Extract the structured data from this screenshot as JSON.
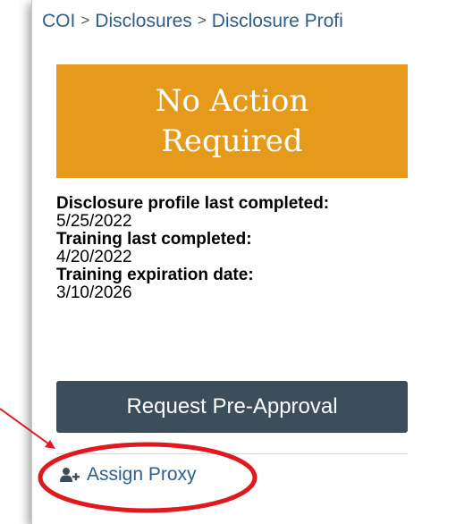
{
  "breadcrumb": [
    "COI",
    "Disclosures",
    "Disclosure Profi"
  ],
  "breadcrumb_separator": ">",
  "status": {
    "text": "No Action Required",
    "color": "#e59a1c"
  },
  "profile": [
    {
      "label": "Disclosure profile last completed:",
      "value": "5/25/2022"
    },
    {
      "label": "Training last completed:",
      "value": "4/20/2022"
    },
    {
      "label": "Training expiration date:",
      "value": "3/10/2026"
    }
  ],
  "actions": {
    "request_pre_approval": "Request Pre-Approval",
    "assign_proxy": "Assign Proxy",
    "assign_proxy_icon": "user-plus-icon"
  },
  "colors": {
    "link": "#2e5f8a",
    "button_bg": "#3d4e5b",
    "annotation": "#e0191e"
  }
}
